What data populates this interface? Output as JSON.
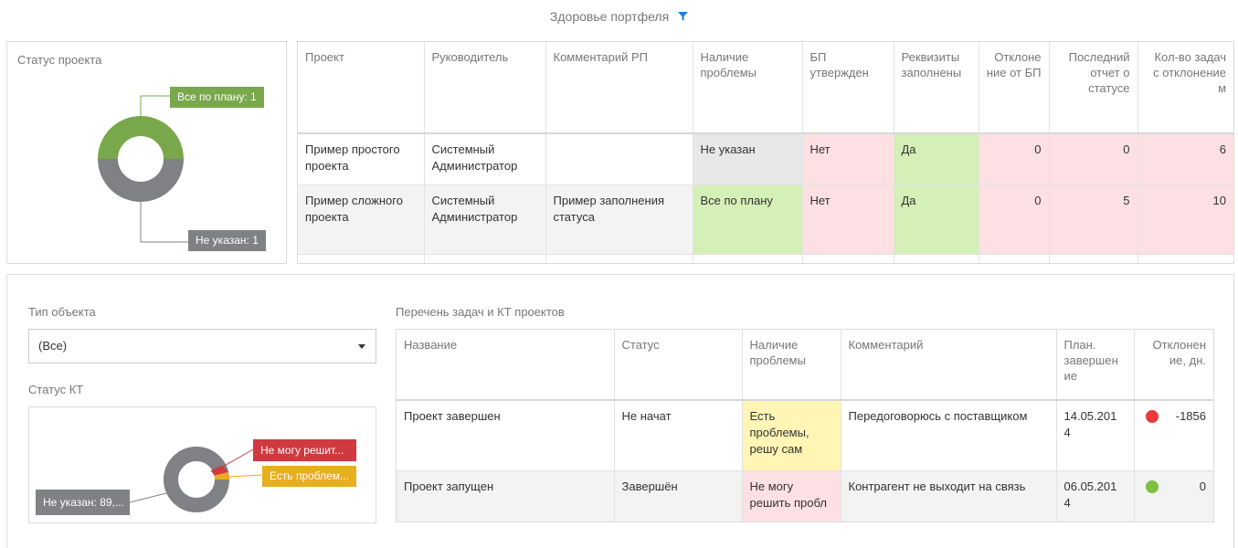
{
  "page": {
    "title": "Здоровье портфеля"
  },
  "colors": {
    "green": "#78a84b",
    "grey": "#7f8184",
    "red": "#d0393f",
    "orange": "#e8ae1e",
    "dot_red": "#e83a3a",
    "dot_green": "#7fc042"
  },
  "status_panel": {
    "label": "Статус проекта",
    "callouts": {
      "top": "Все по плану: 1",
      "bottom": "Не указан: 1"
    }
  },
  "projects_table": {
    "headers": [
      "Проект",
      "Руководитель",
      "Комментарий РП",
      "Наличие проблемы",
      "БП утвержден",
      "Реквизиты заполнены",
      "Отклоне ние от БП",
      "Последний отчет о статусе",
      "Кол-во задач с отклонение м"
    ],
    "rows": [
      {
        "project": "Пример простого проекта",
        "manager": "Системный Администратор",
        "comment": "",
        "problem": "Не указан",
        "bp": "Нет",
        "requisites": "Да",
        "deviation": "0",
        "last_report": "0",
        "tasks_dev": "6"
      },
      {
        "project": "Пример сложного проекта",
        "manager": "Системный Администратор",
        "comment": "Пример заполнения статуса",
        "problem": "Все по плану",
        "bp": "Нет",
        "requisites": "Да",
        "deviation": "0",
        "last_report": "5",
        "tasks_dev": "10"
      }
    ]
  },
  "object_type": {
    "label": "Тип объекта",
    "selected": "(Все)"
  },
  "kt_status": {
    "label": "Статус КТ",
    "callouts": {
      "red": "Не могу решит...",
      "orange": "Есть проблем...",
      "grey": "Не указан: 89,..."
    }
  },
  "tasks_table": {
    "label": "Перечень задач и КТ проектов",
    "headers": [
      "Название",
      "Статус",
      "Наличие проблемы",
      "Комментарий",
      "План. завершен ие",
      "Отклонен ие, дн."
    ],
    "rows": [
      {
        "name": "Проект завершен",
        "status": "Не начат",
        "problem": "Есть проблемы, решу сам",
        "comment": "Передоговорюсь с поставщиком",
        "plan": "14.05.201 4",
        "deviation": "-1856"
      },
      {
        "name": "Проект запущен",
        "status": "Завершён",
        "problem": "Не могу решить пробл",
        "comment": "Контрагент не выходит на связь",
        "plan": "06.05.201 4",
        "deviation": "0"
      }
    ]
  }
}
